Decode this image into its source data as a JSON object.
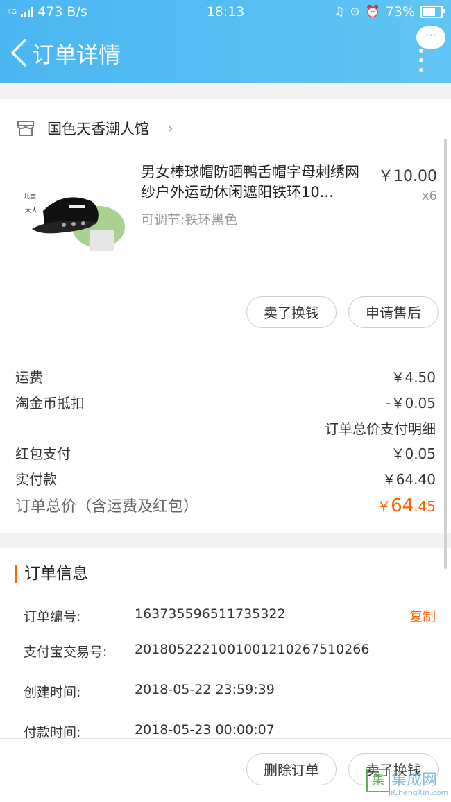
{
  "status_bar": {
    "network": "4G",
    "speed": "473 B/s",
    "time": "18:13",
    "battery": "73%",
    "battery_level": 0.73
  },
  "nav": {
    "title": "订单详情",
    "menu_label": "···"
  },
  "shop": {
    "name": "国色天香潮人馆"
  },
  "product": {
    "title": "男女棒球帽防晒鸭舌帽字母刺绣网纱户外运动休闲遮阳铁环10...",
    "sku": "可调节;铁环黑色",
    "price": "￥10.00",
    "qty": "x6",
    "img_tag_1": "儿童",
    "img_tag_2": "大人"
  },
  "item_actions": {
    "sell": "卖了换钱",
    "aftersale": "申请售后"
  },
  "costs": {
    "shipping_label": "运费",
    "shipping_value": "￥4.50",
    "coin_label": "淘金币抵扣",
    "coin_value": "-￥0.05",
    "detail_link": "订单总价支付明细",
    "redpacket_label": "红包支付",
    "redpacket_value": "￥0.05",
    "paid_label": "实付款",
    "paid_value": "￥64.40",
    "total_label": "订单总价（含运费及红包）",
    "total_currency": "￥",
    "total_int": "64",
    "total_dec": ".45"
  },
  "order_info": {
    "heading": "订单信息",
    "order_no_label": "订单编号:",
    "order_no": "163735596511735322",
    "copy": "复制",
    "alipay_label": "支付宝交易号:",
    "alipay_no": "2018052221001001210267510266",
    "created_label": "创建时间:",
    "created": "2018-05-22 23:59:39",
    "paid_time_label": "付款时间:",
    "paid_time": "2018-05-23 00:00:07"
  },
  "bottom_actions": {
    "delete": "删除订单",
    "sell": "卖了换钱"
  },
  "watermark": {
    "main": "集成网",
    "sub": "JiChengXin.com"
  },
  "colors": {
    "header": "#4bb6f2",
    "accent": "#ff6000"
  }
}
